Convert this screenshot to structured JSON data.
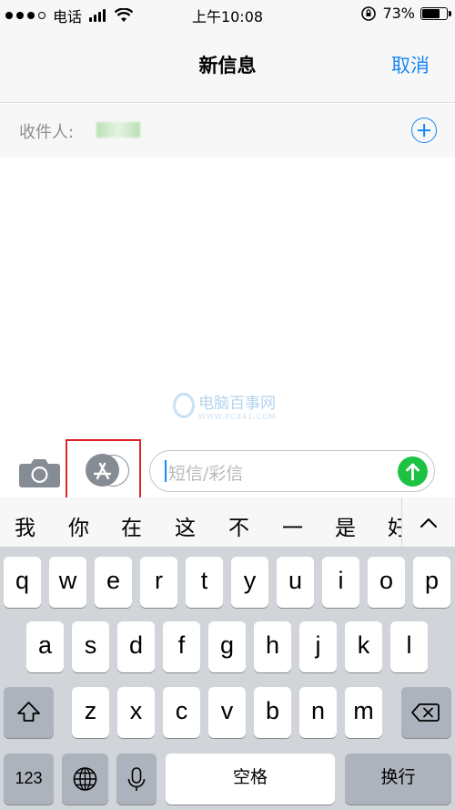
{
  "status_bar": {
    "carrier": "电话",
    "time": "上午10:08",
    "battery_percent": "73%",
    "battery_level": 0.73
  },
  "nav": {
    "title": "新信息",
    "cancel": "取消"
  },
  "recipient": {
    "label": "收件人:",
    "add_icon": "plus-circle-icon"
  },
  "watermark": {
    "title": "电脑百事网",
    "subtitle": "WWW.PC841.COM"
  },
  "compose": {
    "camera_icon": "camera-icon",
    "appstore_icon": "app-store-icon",
    "placeholder": "短信/彩信",
    "send_icon": "arrow-up-icon"
  },
  "candidates": [
    "我",
    "你",
    "在",
    "这",
    "不",
    "一",
    "是",
    "好"
  ],
  "keyboard": {
    "row1": [
      "q",
      "w",
      "e",
      "r",
      "t",
      "y",
      "u",
      "i",
      "o",
      "p"
    ],
    "row2": [
      "a",
      "s",
      "d",
      "f",
      "g",
      "h",
      "j",
      "k",
      "l"
    ],
    "row3": [
      "z",
      "x",
      "c",
      "v",
      "b",
      "n",
      "m"
    ],
    "numbers": "123",
    "space": "空格",
    "return": "换行",
    "shift_icon": "shift-arrow-icon",
    "delete_icon": "delete-backspace-icon",
    "globe_icon": "globe-icon",
    "mic_icon": "microphone-icon"
  },
  "colors": {
    "accent": "#1a87f5",
    "send": "#1ec243",
    "highlight": "#e0242a"
  }
}
